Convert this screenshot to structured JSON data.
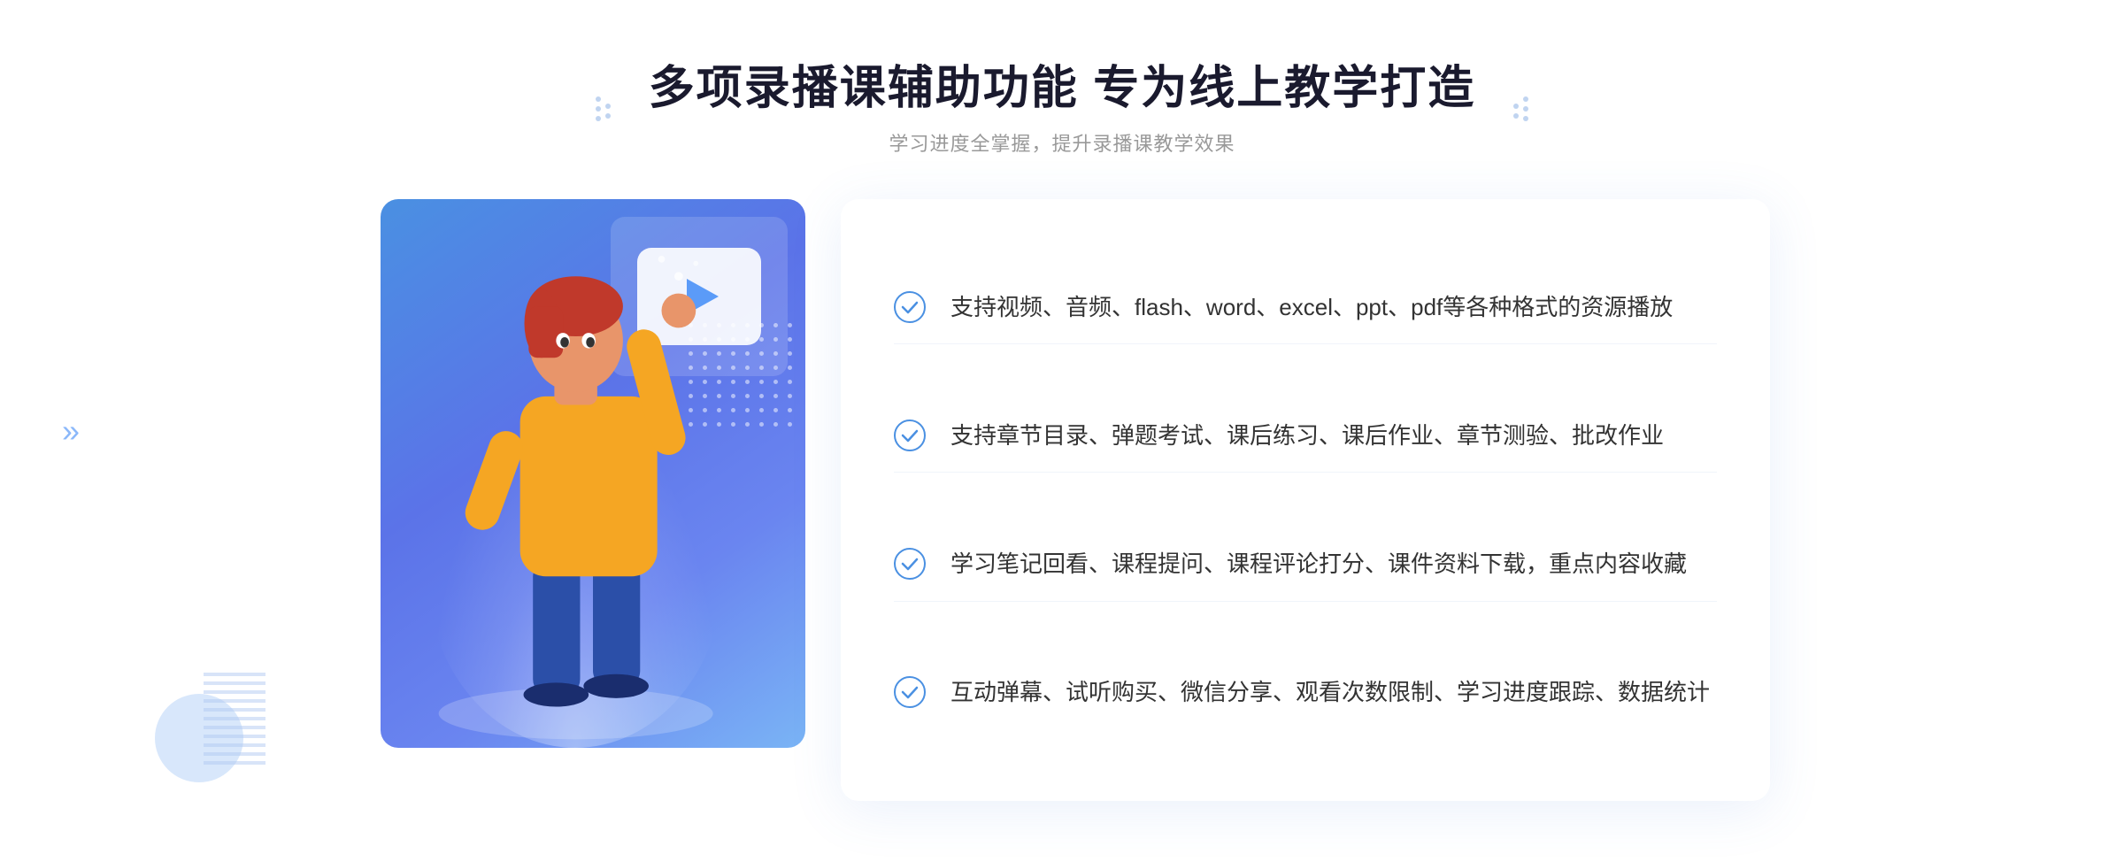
{
  "header": {
    "title": "多项录播课辅助功能 专为线上教学打造",
    "subtitle": "学习进度全掌握，提升录播课教学效果",
    "dots_left_label": "header-dots-left",
    "dots_right_label": "header-dots-right"
  },
  "features": [
    {
      "id": 1,
      "text": "支持视频、音频、flash、word、excel、ppt、pdf等各种格式的资源播放"
    },
    {
      "id": 2,
      "text": "支持章节目录、弹题考试、课后练习、课后作业、章节测验、批改作业"
    },
    {
      "id": 3,
      "text": "学习笔记回看、课程提问、课程评论打分、课件资料下载，重点内容收藏"
    },
    {
      "id": 4,
      "text": "互动弹幕、试听购买、微信分享、观看次数限制、学习进度跟踪、数据统计"
    }
  ],
  "illustration": {
    "play_button_label": "play-button",
    "blue_card_label": "blue-card"
  },
  "colors": {
    "accent": "#4a90e2",
    "accent2": "#5b73e8",
    "text_primary": "#1a1a2e",
    "text_secondary": "#666",
    "text_light": "#999"
  },
  "chevron": "»"
}
